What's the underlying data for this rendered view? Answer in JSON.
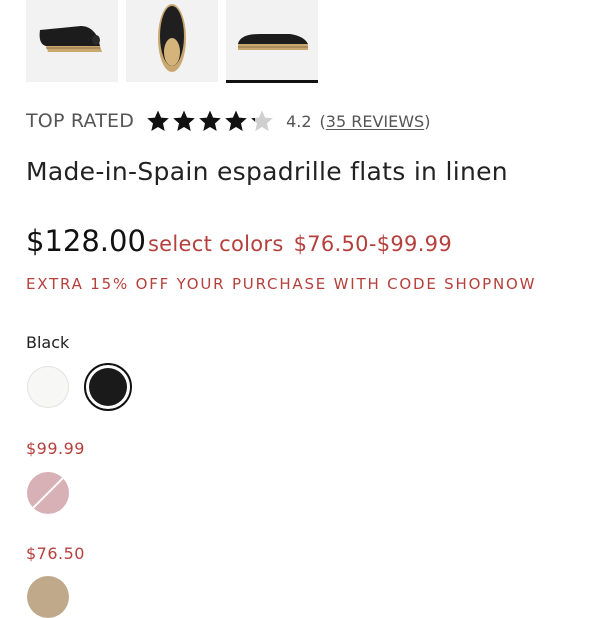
{
  "gallery": {
    "thumbnails": [
      "espadrille-side-view",
      "espadrille-top-view",
      "espadrille-profile-view"
    ],
    "selected_index": 2
  },
  "rating": {
    "top_rated_label": "TOP RATED",
    "stars_filled": 4.2,
    "stars_total": 5,
    "value_text": "4.2",
    "reviews_text": "35 REVIEWS",
    "open_paren": "(",
    "close_paren": ")"
  },
  "product": {
    "title": "Made-in-Spain espadrille flats in linen"
  },
  "pricing": {
    "list_price": "$128.00",
    "select_colors_label": "select colors",
    "sale_range": "$76.50-$99.99",
    "promo_text": "EXTRA 15% OFF YOUR PURCHASE WITH CODE SHOPNOW"
  },
  "colors": {
    "selected_label": "Black",
    "swatches_full_price": [
      {
        "name": "white",
        "hex": "#f7f7f5"
      },
      {
        "name": "black",
        "hex": "#1a1a1a",
        "selected": true
      }
    ],
    "group_99": {
      "price": "$99.99",
      "swatches": [
        {
          "name": "pink",
          "hex": "#d8b1b6",
          "unavailable": true
        }
      ]
    },
    "group_76": {
      "price": "$76.50",
      "swatches": [
        {
          "name": "tan",
          "hex": "#bfa98a"
        }
      ]
    }
  },
  "theme": {
    "accent_red": "#b5403c",
    "text_dark": "#222222"
  }
}
